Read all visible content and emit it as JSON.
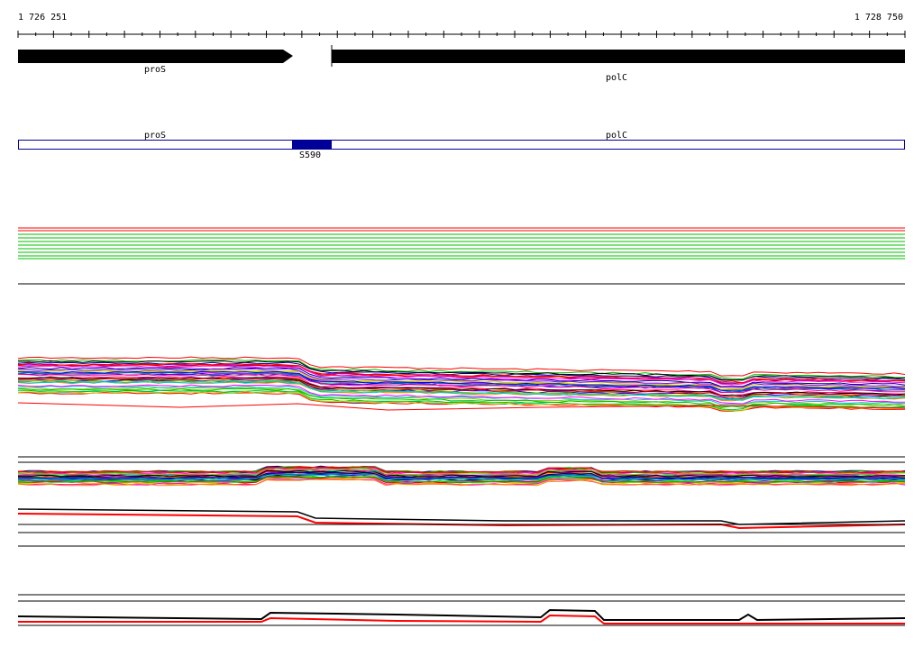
{
  "ruler": {
    "start_label": "1 726 251",
    "end_label": "1 728 750"
  },
  "genes": [
    {
      "name": "proS",
      "strand": "+"
    },
    {
      "name": "polC",
      "strand": "+"
    }
  ],
  "annotation_track": {
    "gene_labels": [
      "proS",
      "polC"
    ],
    "feature_label": "S590",
    "feature_color": "#000099"
  },
  "colors": {
    "flat_lines": [
      "#ff0000",
      "#ff0000",
      "#00c000",
      "#00c000",
      "#00c000",
      "#00c000",
      "#00c000",
      "#00c000"
    ],
    "profile_palette": [
      "#ff0000",
      "#00c000",
      "#0000ff",
      "#ff00ff",
      "#00cccc",
      "#cccc00",
      "#ff8800",
      "#8800ff",
      "#008888",
      "#ff0088",
      "#88cc00",
      "#000088",
      "#cc0000",
      "#000000"
    ],
    "highlight_line": "#ff0000",
    "black_line": "#000000"
  }
}
